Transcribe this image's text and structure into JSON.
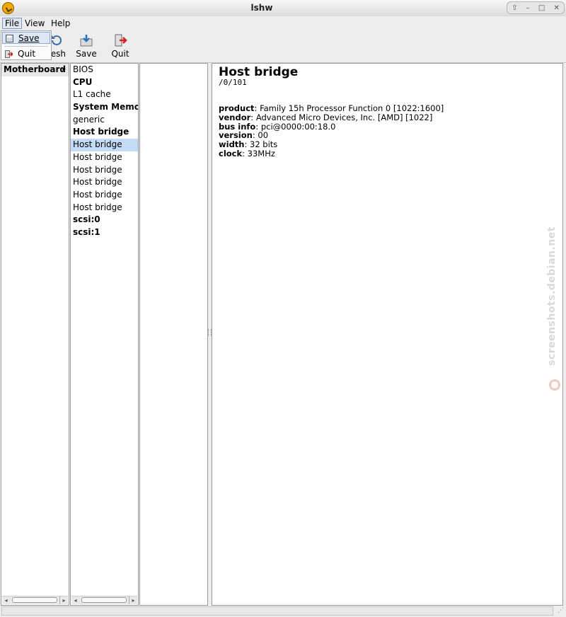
{
  "window": {
    "title": "lshw"
  },
  "menubar": {
    "file": "File",
    "view": "View",
    "help": "Help"
  },
  "file_menu": {
    "save": "Save",
    "quit": "Quit"
  },
  "toolbar": {
    "refresh_partial": "resh",
    "save": "Save",
    "quit": "Quit"
  },
  "pane1": {
    "items": [
      "Motherboard"
    ]
  },
  "pane2": {
    "items": [
      {
        "label": "BIOS"
      },
      {
        "label": "CPU"
      },
      {
        "label": "L1 cache"
      },
      {
        "label": "System Memor"
      },
      {
        "label": "generic"
      },
      {
        "label": "Host bridge"
      },
      {
        "label": "Host bridge"
      },
      {
        "label": "Host bridge"
      },
      {
        "label": "Host bridge"
      },
      {
        "label": "Host bridge"
      },
      {
        "label": "Host bridge"
      },
      {
        "label": "Host bridge"
      },
      {
        "label": "scsi:0"
      },
      {
        "label": "scsi:1"
      }
    ],
    "selected_index": 6
  },
  "detail": {
    "title": "Host bridge",
    "path": "/0/101",
    "properties": [
      {
        "key": "product",
        "value": "Family 15h Processor Function 0 [1022:1600]"
      },
      {
        "key": "vendor",
        "value": "Advanced Micro Devices, Inc. [AMD] [1022]"
      },
      {
        "key": "bus info",
        "value": "pci@0000:00:18.0"
      },
      {
        "key": "version",
        "value": "00"
      },
      {
        "key": "width",
        "value": "32 bits"
      },
      {
        "key": "clock",
        "value": "33MHz"
      }
    ]
  },
  "watermark": "screenshots.debian.net",
  "colors": {
    "selection": "#c4dbf7",
    "menu_highlight": "#dde8f6"
  }
}
